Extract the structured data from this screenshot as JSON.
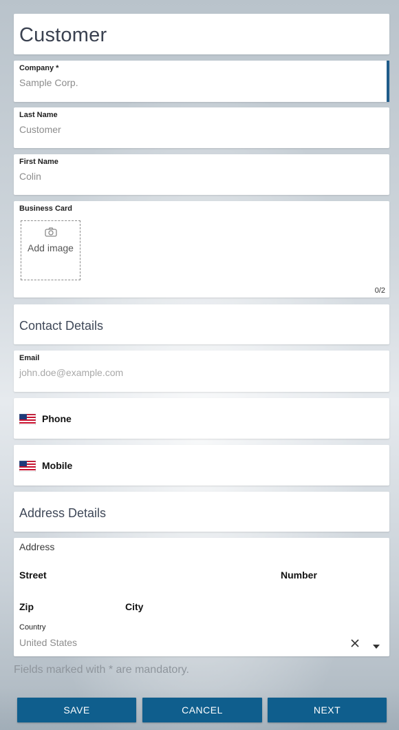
{
  "title": "Customer",
  "fields": {
    "company": {
      "label": "Company *",
      "value": "Sample Corp."
    },
    "last_name": {
      "label": "Last Name",
      "value": "Customer"
    },
    "first_name": {
      "label": "First Name",
      "value": "Colin"
    },
    "business_card": {
      "label": "Business Card",
      "add_label": "Add image",
      "count": "0/2"
    },
    "email": {
      "label": "Email",
      "placeholder": "john.doe@example.com"
    },
    "phone": {
      "label": "Phone"
    },
    "mobile": {
      "label": "Mobile"
    }
  },
  "sections": {
    "contact": "Contact Details",
    "address": "Address Details"
  },
  "address": {
    "header": "Address",
    "street": "Street",
    "number": "Number",
    "zip": "Zip",
    "city": "City",
    "country_label": "Country",
    "country_value": "United States"
  },
  "hint": "Fields marked with * are mandatory.",
  "buttons": {
    "save": "SAVE",
    "cancel": "CANCEL",
    "next": "NEXT"
  },
  "colors": {
    "accent": "#0f5e8d",
    "active_indicator": "#1f5c8a"
  },
  "icons": {
    "camera": "camera-icon",
    "flag": "us-flag-icon",
    "clear": "close-icon",
    "dropdown": "caret-down-icon"
  }
}
